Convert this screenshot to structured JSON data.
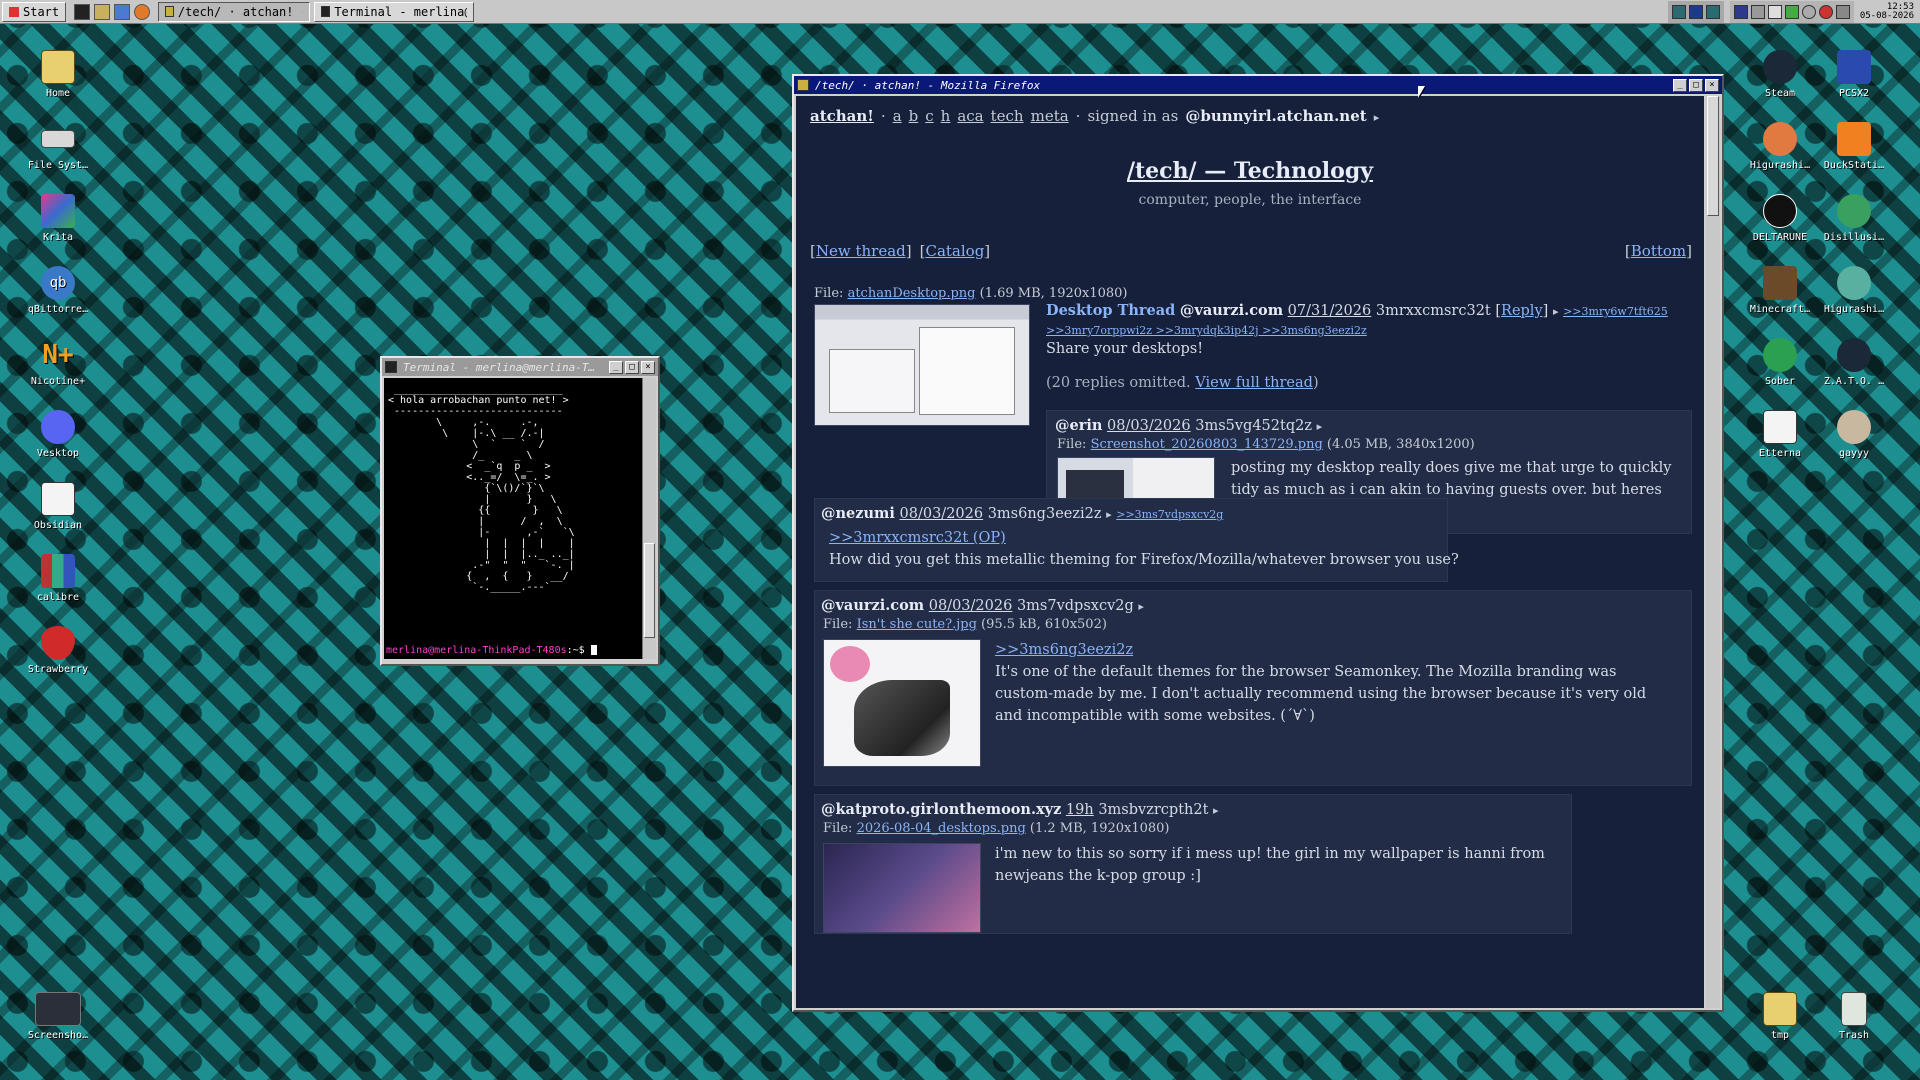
{
  "taskbar": {
    "start_label": "Start",
    "tasks": [
      {
        "label": "/tech/ · atchan! - Moz…"
      },
      {
        "label": "Terminal - merlina@mer…"
      }
    ],
    "clock_time": "12:53",
    "clock_date": "05-08-2026"
  },
  "desktop_left": [
    {
      "label": "Home",
      "icon": "folder-icon"
    },
    {
      "label": "File Syst…",
      "icon": "drive-icon"
    },
    {
      "label": "Krita",
      "icon": "krita-icon"
    },
    {
      "label": "qBittorre…",
      "icon": "qbittorrent-icon"
    },
    {
      "label": "Nicotine+",
      "icon": "nicotine-icon"
    },
    {
      "label": "Vesktop",
      "icon": "discord-icon"
    },
    {
      "label": "Obsidian",
      "icon": "obsidian-icon"
    },
    {
      "label": "calibre",
      "icon": "books-icon"
    },
    {
      "label": "Strawberry",
      "icon": "strawberry-icon"
    },
    {
      "label": "Screensho…",
      "icon": "screenshot-icon"
    }
  ],
  "desktop_right": [
    {
      "label": "Steam"
    },
    {
      "label": "PCSX2"
    },
    {
      "label": "Higurashi…"
    },
    {
      "label": "DuckStati…"
    },
    {
      "label": "DELTARUNE"
    },
    {
      "label": "Disillusi…"
    },
    {
      "label": "Minecraft…"
    },
    {
      "label": "Higurashi…"
    },
    {
      "label": "Sober"
    },
    {
      "label": "Z.A.T.O. …"
    },
    {
      "label": "Etterna"
    },
    {
      "label": "gayyy"
    },
    {
      "label": "tmp"
    },
    {
      "label": "Trash"
    }
  ],
  "terminal": {
    "title": "Terminal - merlina@merlina-T…",
    "lines": [
      " ____________________________",
      "< hola arrobachan punto net! >",
      " ----------------------------",
      "        \\     ,-.     .-,",
      "         \\    |-.\\ __ /.-|",
      "              \\  `    `  /",
      "              /_     _ \\",
      "             <  _`q  p _  >",
      "             <.._=/  \\=_. >",
      "                {`\\()/`}`\\",
      "                |      }   \\",
      "               {{       }   \\",
      "               |      /  ,  \\",
      "               |-      ,-`   `\\",
      "                |  |  |  |    |",
      "                |  |  |.._ .._|",
      "              .-\"  \"  \"   `-. |",
      "             {  ,  {   }   __/",
      "              `-._____.---`"
    ],
    "prompt": "merlina@merlina-ThinkPad-T480s",
    "prompt_suffix": ":~$"
  },
  "firefox": {
    "title": "/tech/ · atchan! - Mozilla Firefox",
    "nav": {
      "brand": "atchan!",
      "boards": [
        "a",
        "b",
        "c",
        "h",
        "aca",
        "tech",
        "meta"
      ],
      "signed_in_prefix": "signed in as",
      "user": "@bunnyirl.atchan.net",
      "arrow": "▸"
    },
    "board_title": "/tech/ — Technology",
    "board_subtitle": "computer, people, the interface",
    "new_thread": "New thread",
    "catalog": "Catalog",
    "bottom": "Bottom",
    "op": {
      "file_prefix": "File:",
      "file_name": "atchanDesktop.png",
      "file_info": "(1.69 MB, 1920x1080)",
      "subject": "Desktop Thread",
      "author": "@vaurzi.com",
      "date": "07/31/2026",
      "id": "3mrxxcmsrc32t",
      "reply_label": "Reply",
      "backlinks_1": ">>3mry6w7tft625",
      "backlinks_2": ">>3mry7orppwi2z >>3mrydqk3ip42j >>3ms6ng3eezi2z",
      "body": "Share your desktops!",
      "omitted_prefix": "(20 replies omitted.",
      "omitted_link": "View full thread",
      "omitted_suffix": ")"
    },
    "replies": [
      {
        "author": "@erin",
        "date": "08/03/2026",
        "id": "3ms5vg452tq2z",
        "file_prefix": "File:",
        "file_name": "Screenshot_20260803_143729.png",
        "file_info": "(4.05 MB, 3840x1200)",
        "body": "posting my desktop really does give me that urge to quickly tidy as much as i can akin to having guests over. but heres mine."
      },
      {
        "author": "@nezumi",
        "date": "08/03/2026",
        "id": "3ms6ng3eezi2z",
        "backlink": ">>3ms7vdpsxcv2g",
        "quote": ">>3mrxxcmsrc32t (OP)",
        "body": "How did you get this metallic theming for Firefox/Mozilla/whatever browser you use?"
      },
      {
        "author": "@vaurzi.com",
        "date": "08/03/2026",
        "id": "3ms7vdpsxcv2g",
        "file_prefix": "File:",
        "file_name": "Isn't she cute?.jpg",
        "file_info": "(95.5 kB, 610x502)",
        "quote": ">>3ms6ng3eezi2z",
        "body": "It's one of the default themes for the browser Seamonkey. The Mozilla branding was custom-made by me. I don't actually recommend using the browser because it's very old and incompatible with some websites. (´∀`)"
      },
      {
        "author": "@katproto.girlonthemoon.xyz",
        "date": "19h",
        "id": "3msbvzrcpth2t",
        "file_prefix": "File:",
        "file_name": "2026-08-04_desktops.png",
        "file_info": "(1.2 MB, 1920x1080)",
        "body": "i'm new to this so sorry if i mess up! the girl in my wallpaper is hanni from newjeans the k-pop group :]"
      }
    ]
  },
  "colors": {
    "desktop_teal": "#1e8f90",
    "page_bg": "#16203a",
    "link": "#8ab4f8",
    "titlebar_active": "#0a1878",
    "terminal_prompt": "#ff3dd0"
  }
}
